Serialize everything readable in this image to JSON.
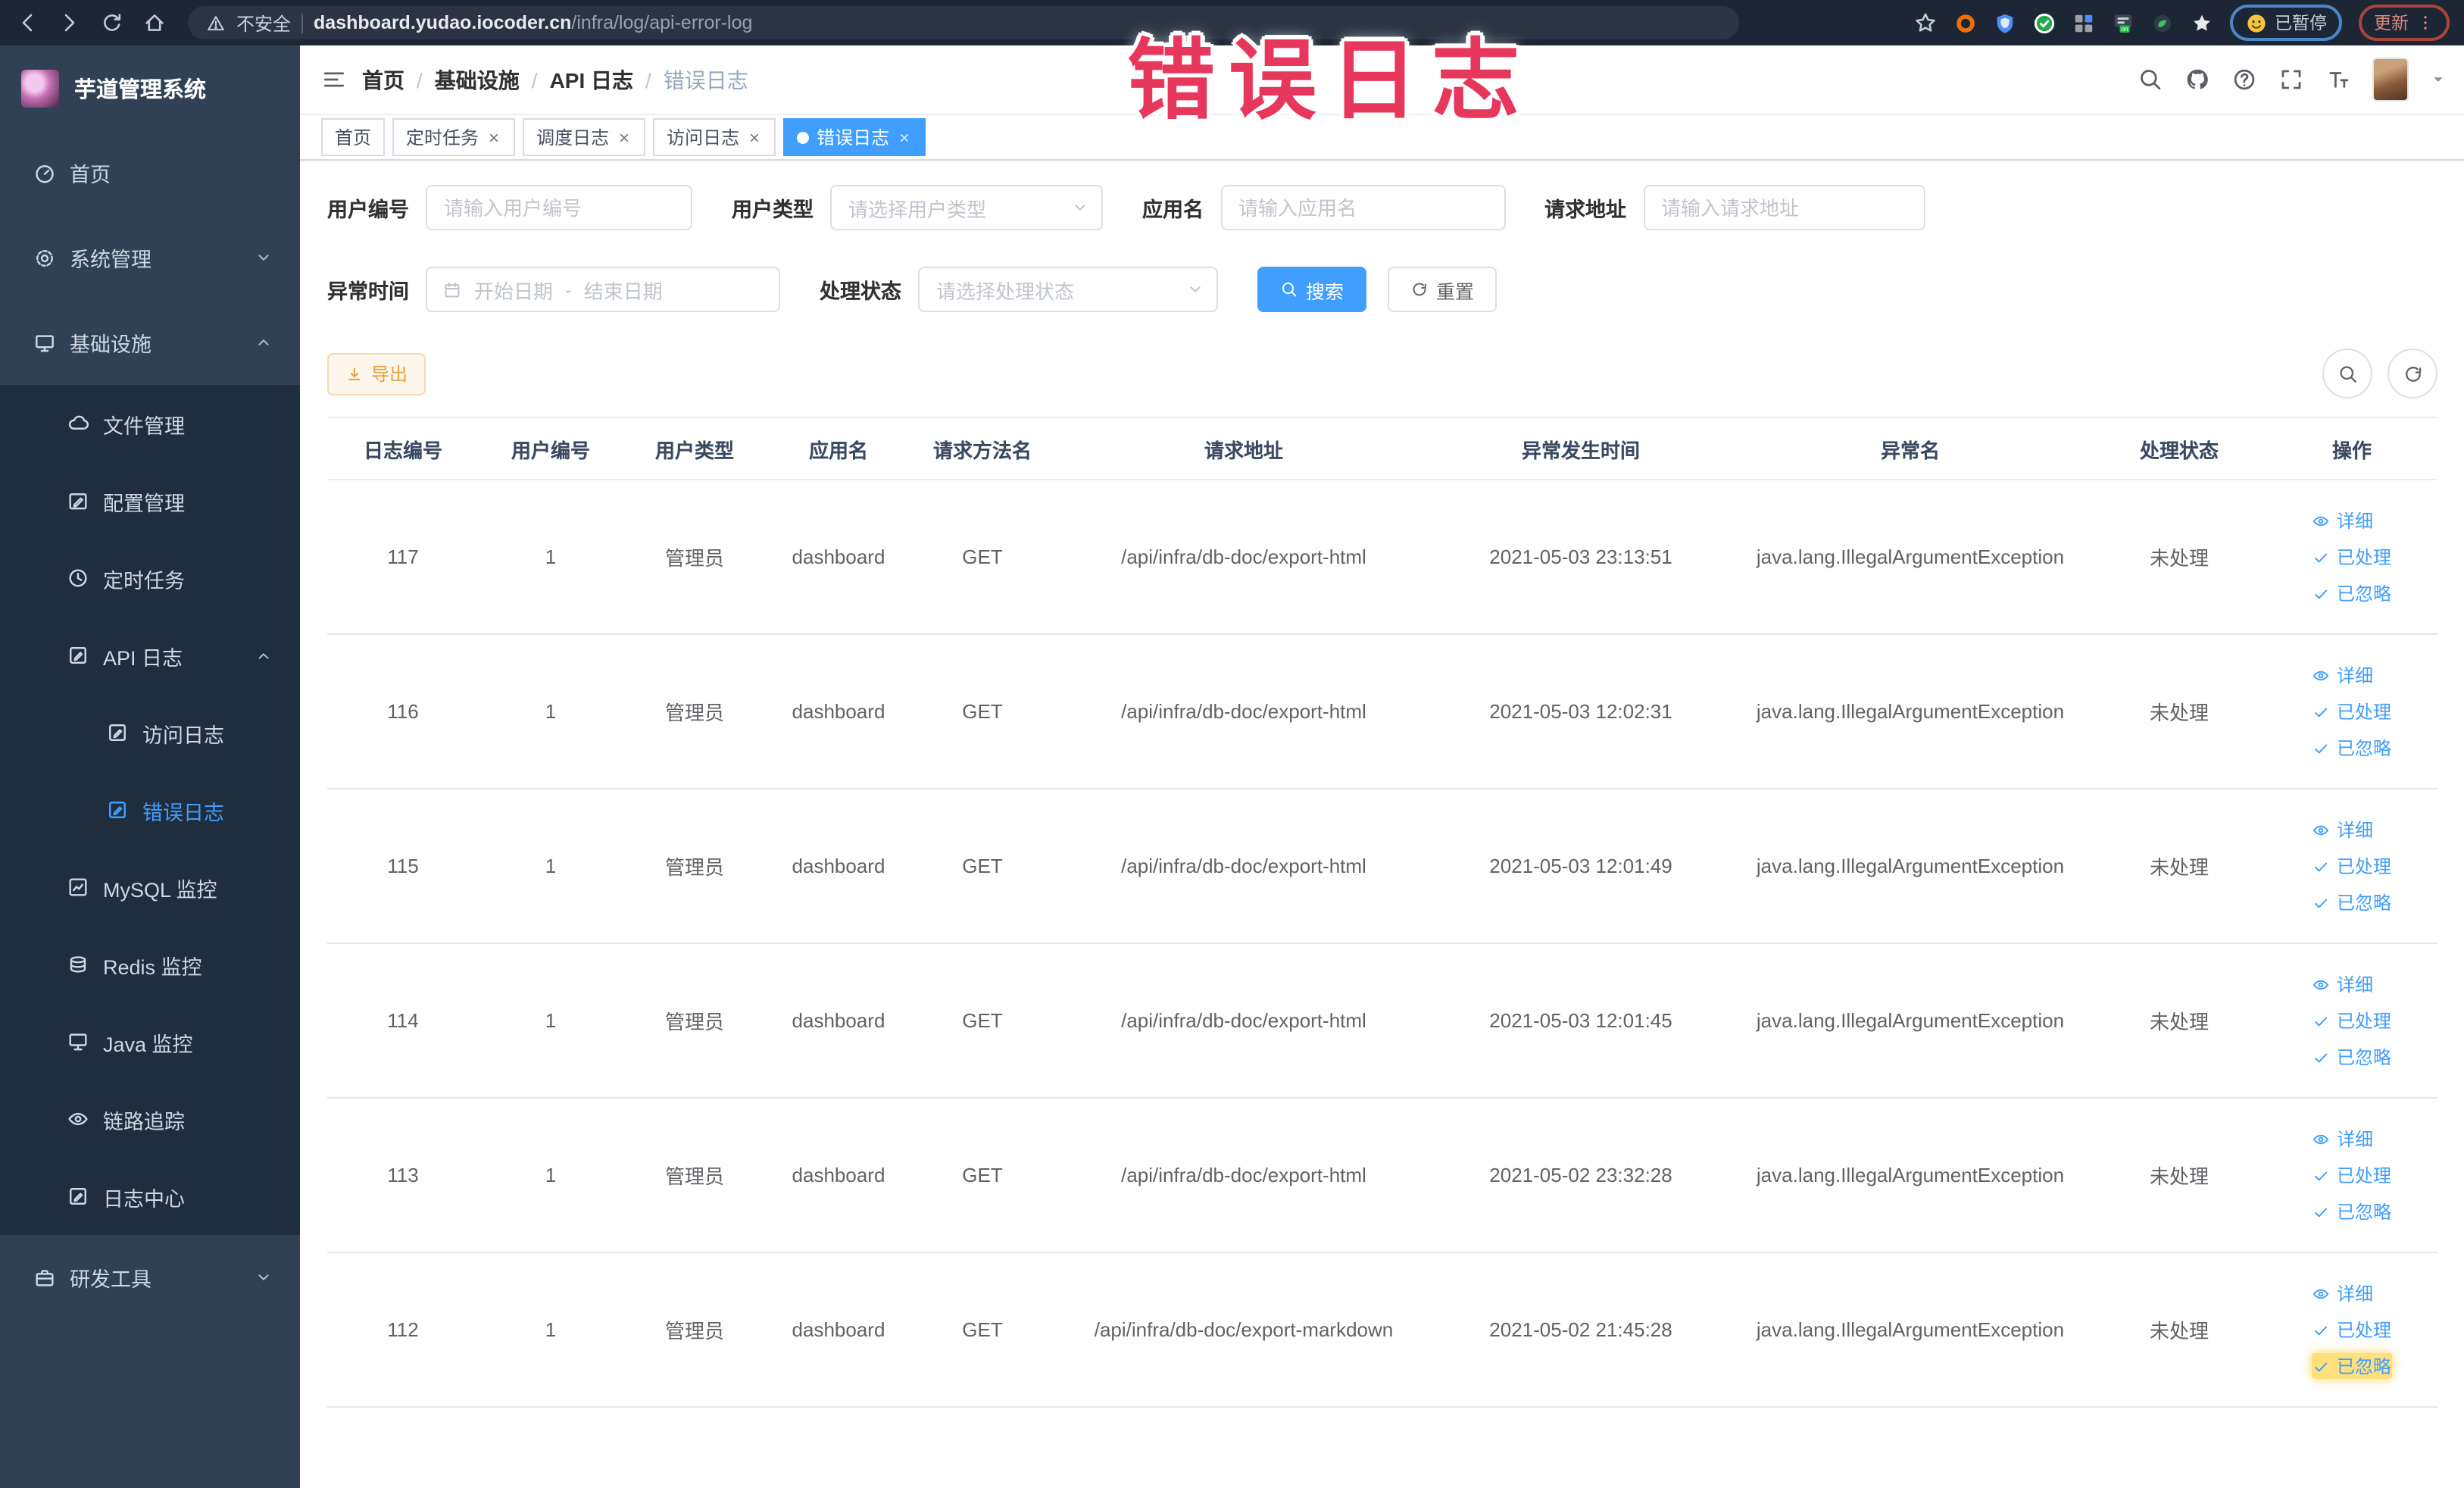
{
  "browser": {
    "security_label": "不安全",
    "url_host": "dashboard.yudao.iocoder.cn",
    "url_path": "/infra/log/api-error-log",
    "paused_badge": "已暂停",
    "update_badge": "更新"
  },
  "annotation": {
    "text": "错误日志"
  },
  "sidebar": {
    "logo_title": "芋道管理系统",
    "items": [
      {
        "label": "首页",
        "icon": "dashboard-icon",
        "level": 1
      },
      {
        "label": "系统管理",
        "icon": "gear-icon",
        "level": 1,
        "arrow": "down"
      },
      {
        "label": "基础设施",
        "icon": "monitor-icon",
        "level": 1,
        "arrow": "up"
      },
      {
        "label": "文件管理",
        "icon": "cloud-icon",
        "level": 2
      },
      {
        "label": "配置管理",
        "icon": "edit-icon",
        "level": 2
      },
      {
        "label": "定时任务",
        "icon": "clock-icon",
        "level": 2
      },
      {
        "label": "API 日志",
        "icon": "doc-icon",
        "level": 2,
        "arrow": "up"
      },
      {
        "label": "访问日志",
        "icon": "doc-icon",
        "level": 3
      },
      {
        "label": "错误日志",
        "icon": "doc-icon",
        "level": 3,
        "active": true
      },
      {
        "label": "MySQL 监控",
        "icon": "chart-icon",
        "level": 2
      },
      {
        "label": "Redis 监控",
        "icon": "layers-icon",
        "level": 2
      },
      {
        "label": "Java 监控",
        "icon": "display-icon",
        "level": 2
      },
      {
        "label": "链路追踪",
        "icon": "eye-icon",
        "level": 2
      },
      {
        "label": "日志中心",
        "icon": "doc-icon",
        "level": 2
      },
      {
        "label": "研发工具",
        "icon": "briefcase-icon",
        "level": 1,
        "arrow": "down"
      }
    ]
  },
  "header": {
    "breadcrumb": [
      "首页",
      "基础设施",
      "API 日志",
      "错误日志"
    ]
  },
  "tabs": [
    {
      "label": "首页",
      "closable": false,
      "active": false
    },
    {
      "label": "定时任务",
      "closable": true,
      "active": false
    },
    {
      "label": "调度日志",
      "closable": true,
      "active": false
    },
    {
      "label": "访问日志",
      "closable": true,
      "active": false
    },
    {
      "label": "错误日志",
      "closable": true,
      "active": true
    }
  ],
  "filters": {
    "user_id": {
      "label": "用户编号",
      "placeholder": "请输入用户编号"
    },
    "user_type": {
      "label": "用户类型",
      "placeholder": "请选择用户类型"
    },
    "app_name": {
      "label": "应用名",
      "placeholder": "请输入应用名"
    },
    "request_url": {
      "label": "请求地址",
      "placeholder": "请输入请求地址"
    },
    "exception_time": {
      "label": "异常时间",
      "start_placeholder": "开始日期",
      "separator": "-",
      "end_placeholder": "结束日期"
    },
    "process_status": {
      "label": "处理状态",
      "placeholder": "请选择处理状态"
    },
    "search_label": "搜索",
    "reset_label": "重置"
  },
  "toolbar": {
    "export_label": "导出"
  },
  "table": {
    "headers": [
      "日志编号",
      "用户编号",
      "用户类型",
      "应用名",
      "请求方法名",
      "请求地址",
      "异常发生时间",
      "异常名",
      "处理状态",
      "操作"
    ],
    "actions": [
      {
        "label": "详细",
        "icon": "view-icon"
      },
      {
        "label": "已处理",
        "icon": "check-icon"
      },
      {
        "label": "已忽略",
        "icon": "check-icon"
      }
    ],
    "rows": [
      {
        "id": "117",
        "user_id": "1",
        "user_type": "管理员",
        "app": "dashboard",
        "method": "GET",
        "url": "/api/infra/db-doc/export-html",
        "time": "2021-05-03 23:13:51",
        "exception": "java.lang.IllegalArgumentException",
        "status": "未处理"
      },
      {
        "id": "116",
        "user_id": "1",
        "user_type": "管理员",
        "app": "dashboard",
        "method": "GET",
        "url": "/api/infra/db-doc/export-html",
        "time": "2021-05-03 12:02:31",
        "exception": "java.lang.IllegalArgumentException",
        "status": "未处理"
      },
      {
        "id": "115",
        "user_id": "1",
        "user_type": "管理员",
        "app": "dashboard",
        "method": "GET",
        "url": "/api/infra/db-doc/export-html",
        "time": "2021-05-03 12:01:49",
        "exception": "java.lang.IllegalArgumentException",
        "status": "未处理"
      },
      {
        "id": "114",
        "user_id": "1",
        "user_type": "管理员",
        "app": "dashboard",
        "method": "GET",
        "url": "/api/infra/db-doc/export-html",
        "time": "2021-05-03 12:01:45",
        "exception": "java.lang.IllegalArgumentException",
        "status": "未处理"
      },
      {
        "id": "113",
        "user_id": "1",
        "user_type": "管理员",
        "app": "dashboard",
        "method": "GET",
        "url": "/api/infra/db-doc/export-html",
        "time": "2021-05-02 23:32:28",
        "exception": "java.lang.IllegalArgumentException",
        "status": "未处理"
      },
      {
        "id": "112",
        "user_id": "1",
        "user_type": "管理员",
        "app": "dashboard",
        "method": "GET",
        "url": "/api/infra/db-doc/export-markdown",
        "time": "2021-05-02 21:45:28",
        "exception": "java.lang.IllegalArgumentException",
        "status": "未处理",
        "highlight_ignore": true
      }
    ]
  },
  "colors": {
    "primary": "#409eff",
    "warning": "#e6a23c",
    "annotation": "#e8375c",
    "sidebar_bg": "#304156",
    "submenu_bg": "#1f2d3d"
  }
}
